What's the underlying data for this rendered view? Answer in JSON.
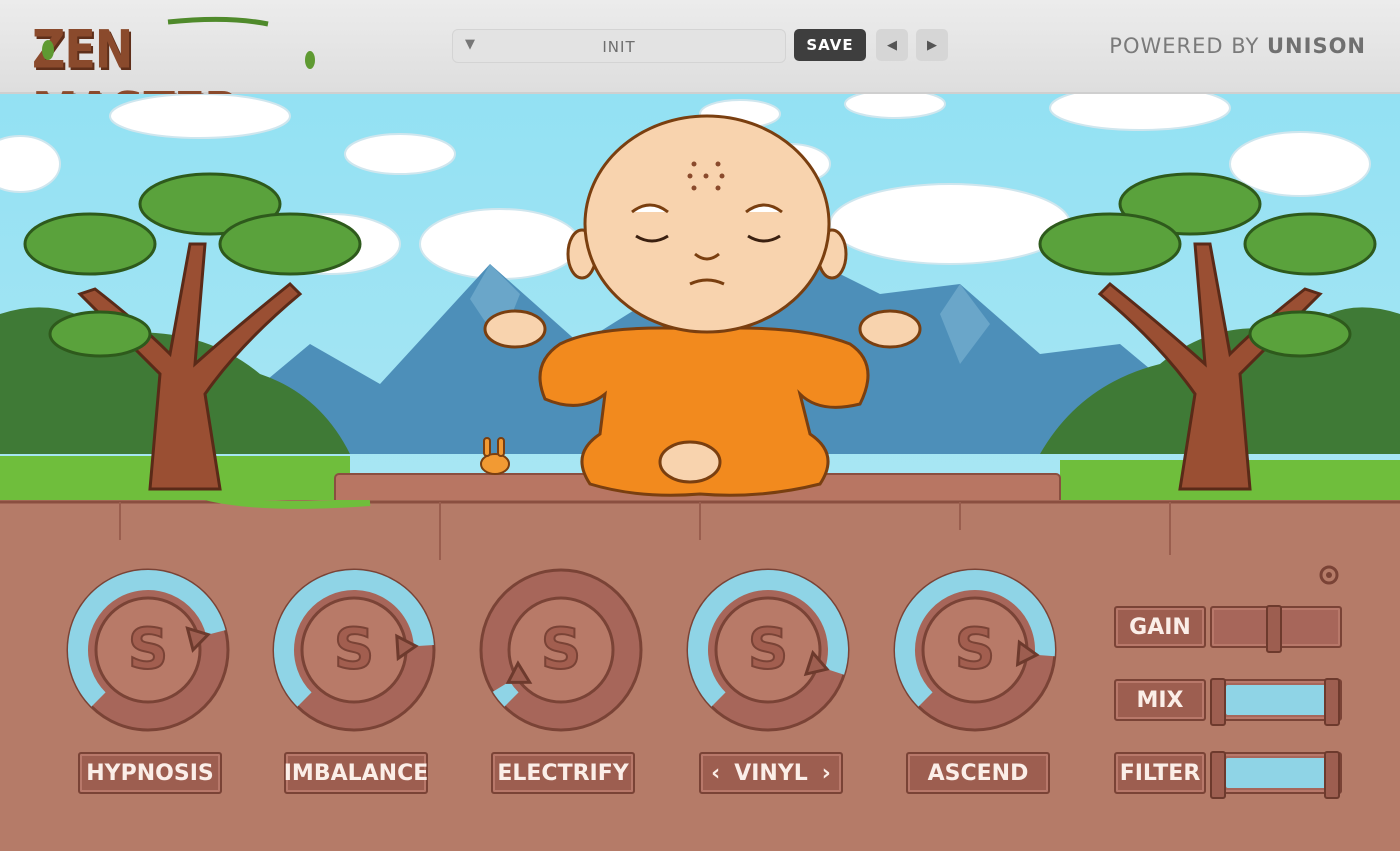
{
  "header": {
    "logo_text": "ZEN MASTER",
    "preset_name": "INIT",
    "save_label": "SAVE",
    "prev_icon": "◀",
    "next_icon": "▶",
    "dropdown_icon": "▼",
    "powered_prefix": "POWERED BY",
    "powered_brand": "UNISON"
  },
  "knobs": [
    {
      "label": "HYPNOSIS",
      "level": 0.78
    },
    {
      "label": "IMBALANCE",
      "level": 0.82
    },
    {
      "label": "ELECTRIFY",
      "level": 0.05
    },
    {
      "label": "VINYL",
      "level": 0.9,
      "has_arrows": true
    },
    {
      "label": "ASCEND",
      "level": 0.85
    }
  ],
  "vinyl_arrows": {
    "left": "‹",
    "right": "›"
  },
  "sliders": [
    {
      "label": "GAIN",
      "level": 0.5
    },
    {
      "label": "MIX",
      "level": 1.0
    },
    {
      "label": "FILTER",
      "level": 1.0
    }
  ],
  "colors": {
    "sky": "#8fdcef",
    "ground": "#b57b68",
    "knob_arc": "#8fd4e6",
    "robe": "#f28a1e"
  }
}
